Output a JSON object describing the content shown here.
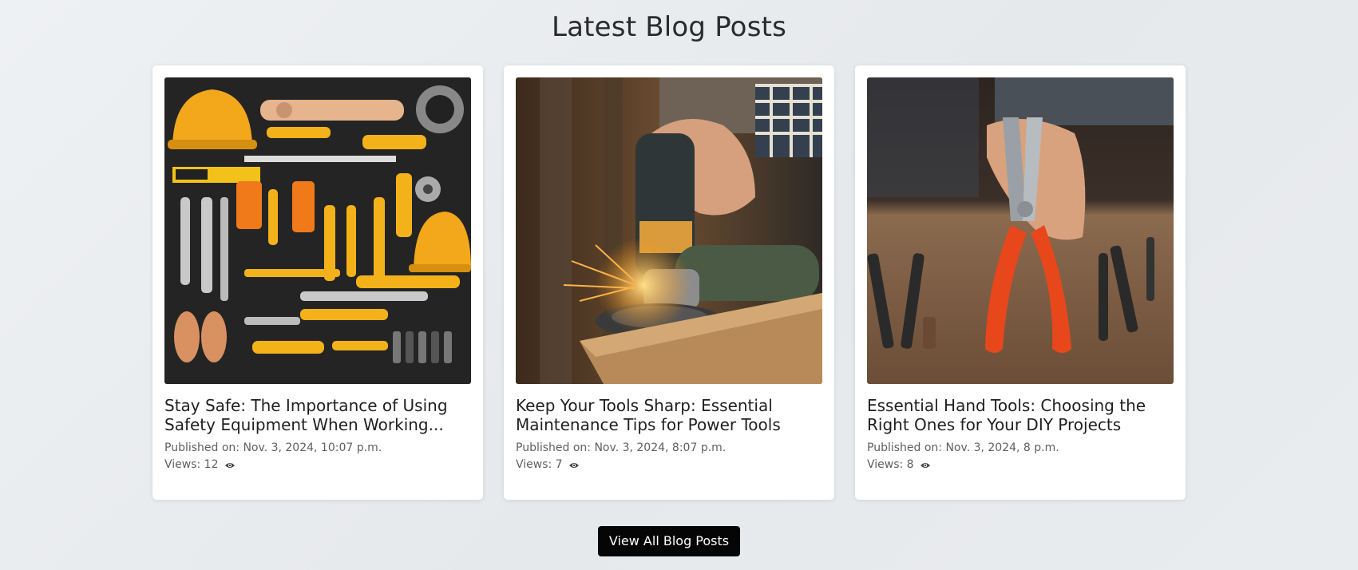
{
  "section": {
    "title": "Latest Blog Posts"
  },
  "posts": [
    {
      "title": "Stay Safe: The Importance of Using Safety Equipment When Working...",
      "published": "Published on: Nov. 3, 2024, 10:07 p.m.",
      "views_label": "Views: 12",
      "image_icon": "tools-flatlay-image"
    },
    {
      "title": "Keep Your Tools Sharp: Essential Maintenance Tips for Power Tools",
      "published": "Published on: Nov. 3, 2024, 8:07 p.m.",
      "views_label": "Views: 7",
      "image_icon": "angle-grinder-image"
    },
    {
      "title": "Essential Hand Tools: Choosing the Right Ones for Your DIY Projects",
      "published": "Published on: Nov. 3, 2024, 8 p.m.",
      "views_label": "Views: 8",
      "image_icon": "pliers-image"
    }
  ],
  "cta": {
    "label": "View All Blog Posts"
  },
  "colors": {
    "button_bg": "#050505",
    "accent_yellow": "#f4b21b",
    "accent_orange": "#e8471c"
  }
}
